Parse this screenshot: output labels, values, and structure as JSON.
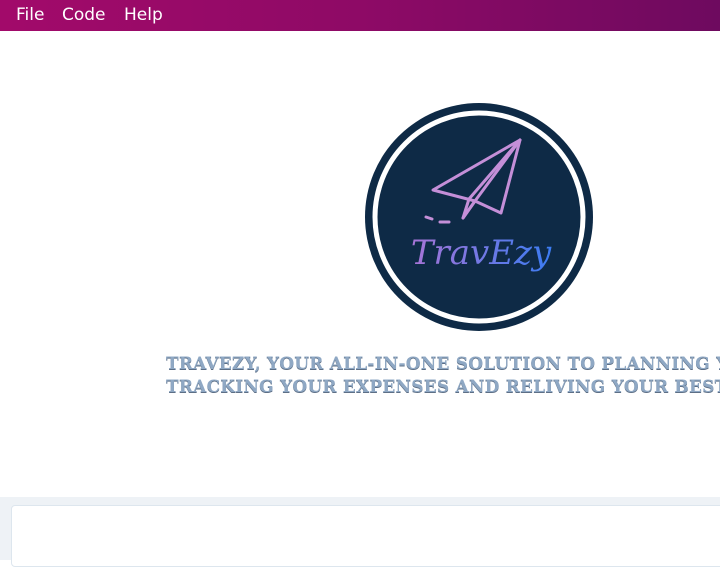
{
  "menubar": {
    "items": [
      {
        "label": "File"
      },
      {
        "label": "Code"
      },
      {
        "label": "Help"
      }
    ]
  },
  "logo": {
    "text": "TravEzy",
    "colors": {
      "circle": "#0e2a46",
      "ring": "#ffffff",
      "plane": "#c48fd8",
      "text_start": "#a874d6",
      "text_end": "#3b7cf2"
    },
    "icon": "paper-plane-icon"
  },
  "hero": {
    "tagline_line1": "TravEzy, your all-in-one solution to planning your",
    "tagline_line2": "tracking your expenses and reliving your best mo"
  },
  "colors": {
    "menubar": "#8e0a66",
    "tagline": "#8fa8c4",
    "lower_area": "#eef2f6"
  }
}
